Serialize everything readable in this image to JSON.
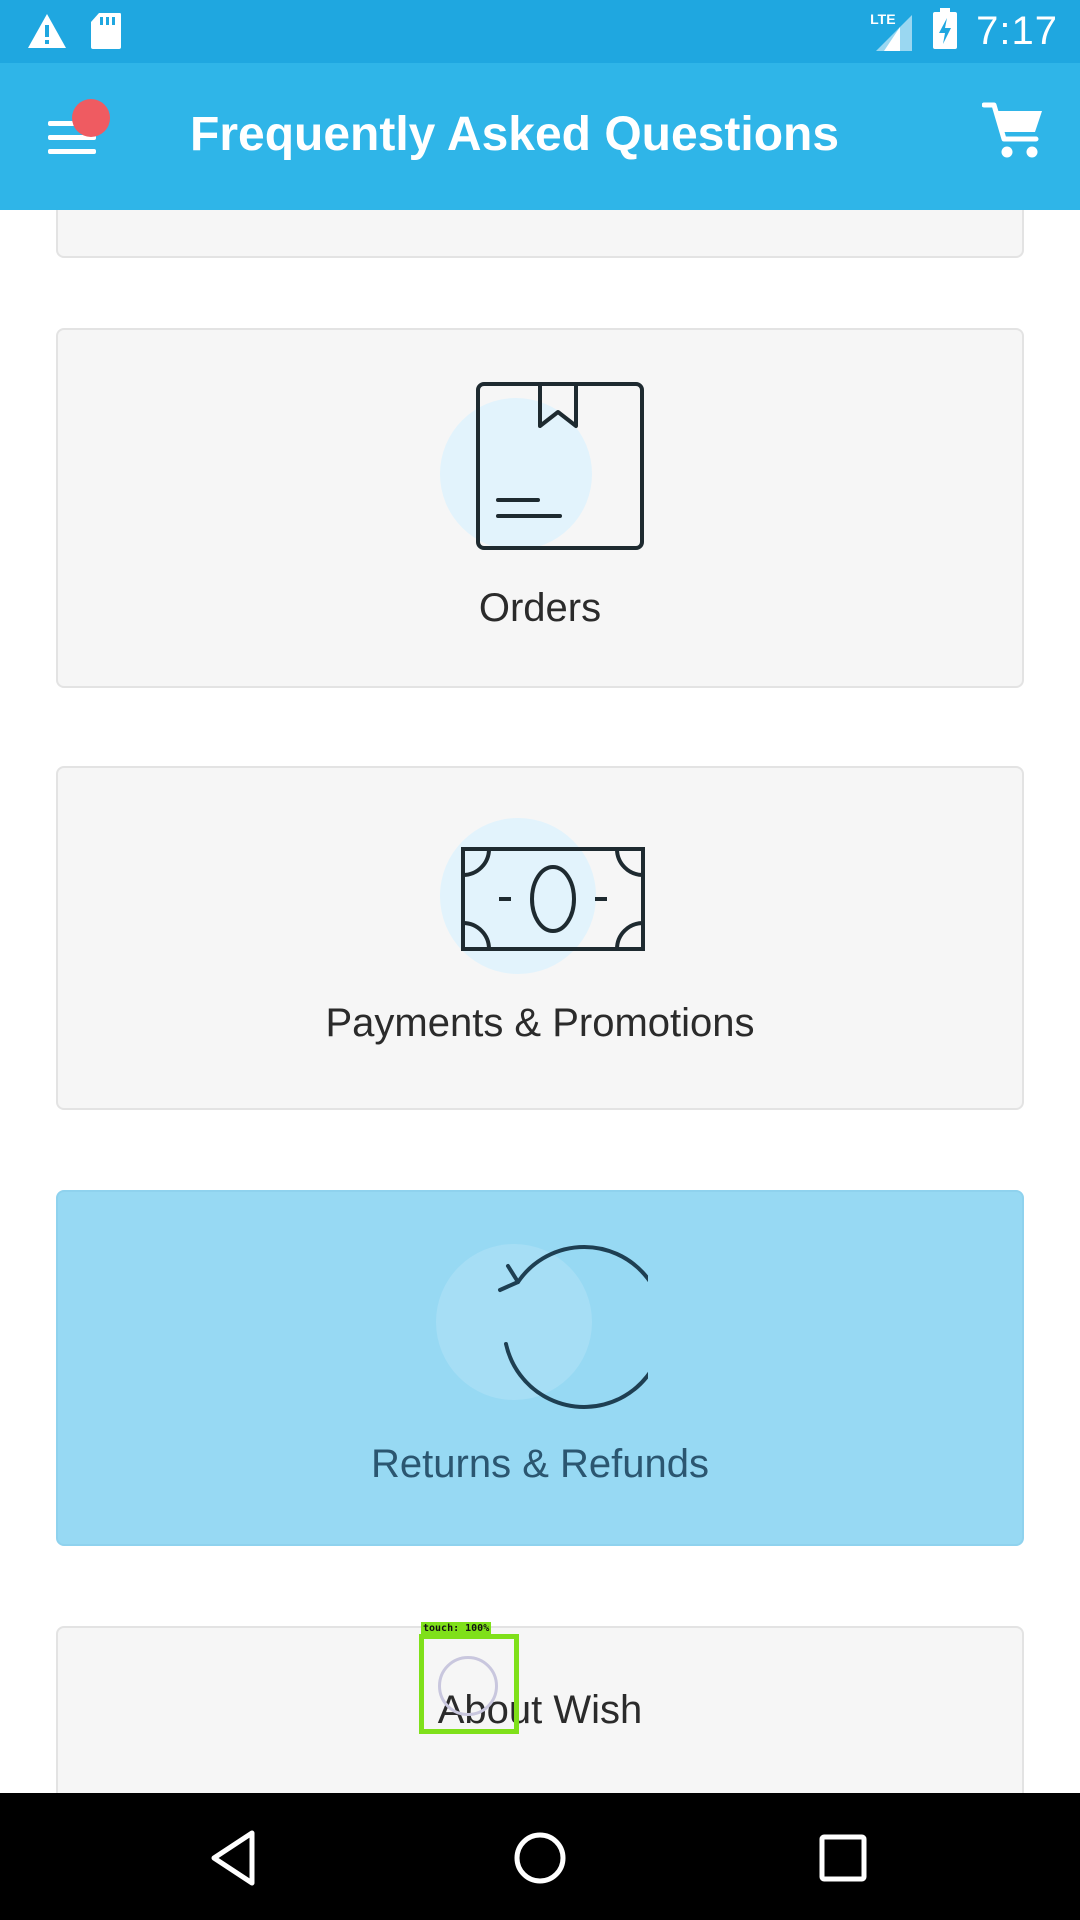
{
  "status_bar": {
    "time": "7:17",
    "network": "LTE",
    "icons": [
      "warning-icon",
      "sd-card-icon",
      "signal-icon",
      "battery-charging-icon"
    ]
  },
  "app_bar": {
    "title": "Frequently Asked Questions",
    "menu_icon": "menu-icon",
    "cart_icon": "cart-icon",
    "notification_color": "#ef5b61"
  },
  "faq_categories": [
    {
      "label": "",
      "icon": ""
    },
    {
      "label": "Orders",
      "icon": "package-icon"
    },
    {
      "label": "Payments & Promotions",
      "icon": "banknote-icon"
    },
    {
      "label": "Returns & Refunds",
      "icon": "refresh-icon",
      "selected": true
    },
    {
      "label": "About Wish",
      "icon": ""
    }
  ],
  "touch_indicator": {
    "label": "touch: 100%"
  },
  "nav_bar": {
    "icons": [
      "back-icon",
      "home-icon",
      "recents-icon"
    ]
  },
  "colors": {
    "status_bar": "#1fa7e0",
    "app_bar": "#2fb5e8",
    "card_bg": "#f6f6f6",
    "card_selected_bg": "#97d9f3",
    "touch_box": "#7fe01a"
  }
}
